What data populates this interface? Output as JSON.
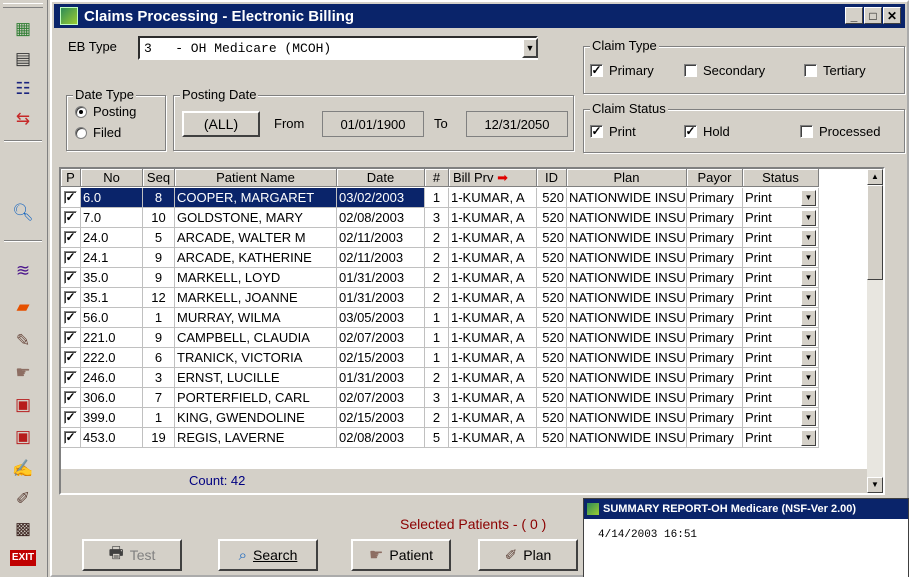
{
  "window": {
    "title": "Claims Processing - Electronic Billing"
  },
  "toolbar": {
    "icons": [
      "grid-icon",
      "notepad-icon",
      "list-icon",
      "swap-icon",
      "find-icon",
      "disk-stack-icon",
      "folder-icon",
      "pen-icon",
      "hand-icon",
      "billing-icon",
      "billing-alt-icon",
      "edit-list-icon",
      "signature-icon",
      "briefcase-icon"
    ],
    "exit_label": "EXIT"
  },
  "eb_type": {
    "label": "EB Type",
    "value": "3   - OH Medicare (MCOH)"
  },
  "date_type": {
    "legend": "Date Type",
    "options": [
      {
        "label": "Posting",
        "selected": true
      },
      {
        "label": "Filed",
        "selected": false
      }
    ]
  },
  "posting_date": {
    "legend": "Posting Date",
    "all_button": "(ALL)",
    "from_label": "From",
    "from_value": "01/01/1900",
    "to_label": "To",
    "to_value": "12/31/2050"
  },
  "claim_type": {
    "legend": "Claim Type",
    "options": [
      {
        "label": "Primary",
        "checked": true
      },
      {
        "label": "Secondary",
        "checked": false
      },
      {
        "label": "Tertiary",
        "checked": false
      }
    ]
  },
  "claim_status": {
    "legend": "Claim Status",
    "options": [
      {
        "label": "Print",
        "checked": true
      },
      {
        "label": "Hold",
        "checked": true
      },
      {
        "label": "Processed",
        "checked": false
      }
    ]
  },
  "grid": {
    "columns": [
      "P",
      "No",
      "Seq",
      "Patient Name",
      "Date",
      "#",
      "Bill Prv",
      "ID",
      "Plan",
      "Payor",
      "Status"
    ],
    "rows": [
      {
        "no": "6.0",
        "seq": "8",
        "name": "COOPER, MARGARET",
        "date": "03/02/2003",
        "n": "1",
        "prv": "1-KUMAR, A",
        "id": "520",
        "plan": "NATIONWIDE INSUF",
        "payor": "Primary",
        "status": "Print",
        "selected": true
      },
      {
        "no": "7.0",
        "seq": "10",
        "name": "GOLDSTONE, MARY",
        "date": "02/08/2003",
        "n": "3",
        "prv": "1-KUMAR, A",
        "id": "520",
        "plan": "NATIONWIDE INSUF",
        "payor": "Primary",
        "status": "Print"
      },
      {
        "no": "24.0",
        "seq": "5",
        "name": "ARCADE, WALTER  M",
        "date": "02/11/2003",
        "n": "2",
        "prv": "1-KUMAR, A",
        "id": "520",
        "plan": "NATIONWIDE INSUF",
        "payor": "Primary",
        "status": "Print"
      },
      {
        "no": "24.1",
        "seq": "9",
        "name": "ARCADE, KATHERINE",
        "date": "02/11/2003",
        "n": "2",
        "prv": "1-KUMAR, A",
        "id": "520",
        "plan": "NATIONWIDE INSUF",
        "payor": "Primary",
        "status": "Print"
      },
      {
        "no": "35.0",
        "seq": "9",
        "name": "MARKELL, LOYD",
        "date": "01/31/2003",
        "n": "2",
        "prv": "1-KUMAR, A",
        "id": "520",
        "plan": "NATIONWIDE INSUF",
        "payor": "Primary",
        "status": "Print"
      },
      {
        "no": "35.1",
        "seq": "12",
        "name": "MARKELL, JOANNE",
        "date": "01/31/2003",
        "n": "2",
        "prv": "1-KUMAR, A",
        "id": "520",
        "plan": "NATIONWIDE INSUF",
        "payor": "Primary",
        "status": "Print"
      },
      {
        "no": "56.0",
        "seq": "1",
        "name": "MURRAY, WILMA",
        "date": "03/05/2003",
        "n": "1",
        "prv": "1-KUMAR, A",
        "id": "520",
        "plan": "NATIONWIDE INSUF",
        "payor": "Primary",
        "status": "Print"
      },
      {
        "no": "221.0",
        "seq": "9",
        "name": "CAMPBELL, CLAUDIA",
        "date": "02/07/2003",
        "n": "1",
        "prv": "1-KUMAR, A",
        "id": "520",
        "plan": "NATIONWIDE INSUF",
        "payor": "Primary",
        "status": "Print"
      },
      {
        "no": "222.0",
        "seq": "6",
        "name": "TRANICK, VICTORIA",
        "date": "02/15/2003",
        "n": "1",
        "prv": "1-KUMAR, A",
        "id": "520",
        "plan": "NATIONWIDE INSUF",
        "payor": "Primary",
        "status": "Print"
      },
      {
        "no": "246.0",
        "seq": "3",
        "name": "ERNST, LUCILLE",
        "date": "01/31/2003",
        "n": "2",
        "prv": "1-KUMAR, A",
        "id": "520",
        "plan": "NATIONWIDE INSUF",
        "payor": "Primary",
        "status": "Print"
      },
      {
        "no": "306.0",
        "seq": "7",
        "name": "PORTERFIELD, CARL",
        "date": "02/07/2003",
        "n": "3",
        "prv": "1-KUMAR, A",
        "id": "520",
        "plan": "NATIONWIDE INSUF",
        "payor": "Primary",
        "status": "Print"
      },
      {
        "no": "399.0",
        "seq": "1",
        "name": "KING, GWENDOLINE",
        "date": "02/15/2003",
        "n": "2",
        "prv": "1-KUMAR, A",
        "id": "520",
        "plan": "NATIONWIDE INSUF",
        "payor": "Primary",
        "status": "Print"
      },
      {
        "no": "453.0",
        "seq": "19",
        "name": "REGIS, LAVERNE",
        "date": "02/08/2003",
        "n": "5",
        "prv": "1-KUMAR, A",
        "id": "520",
        "plan": "NATIONWIDE INSUF",
        "payor": "Primary",
        "status": "Print"
      }
    ],
    "count_label": "Count: 42"
  },
  "selected_patients": "Selected Patients  - ( 0 )",
  "buttons": {
    "test": "Test",
    "search": "Search",
    "patient": "Patient",
    "plan": "Plan"
  },
  "summary": {
    "title": "SUMMARY REPORT-OH Medicare (NSF-Ver 2.00)",
    "timestamp": "4/14/2003 16:51"
  },
  "colors": {
    "title_bar": "#0a246a",
    "face": "#d4d0c8",
    "selection": "#0a246a",
    "accent_text": "#8b0000",
    "arrow": "#e00000",
    "count_text": "#000080"
  }
}
